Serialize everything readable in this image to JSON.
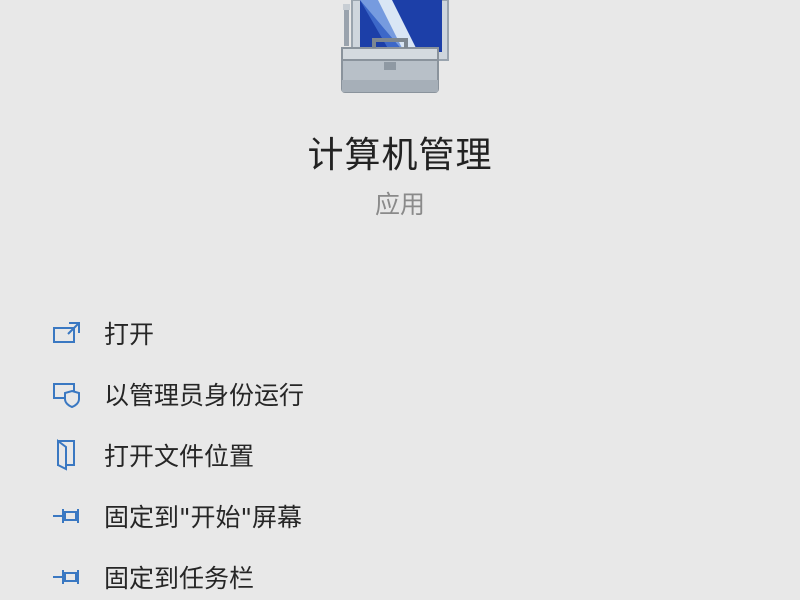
{
  "app": {
    "title": "计算机管理",
    "subtitle": "应用",
    "icon": "computer-management-toolbox-icon"
  },
  "actions": [
    {
      "label": "打开",
      "icon": "open-icon"
    },
    {
      "label": "以管理员身份运行",
      "icon": "run-as-admin-shield-icon"
    },
    {
      "label": "打开文件位置",
      "icon": "file-location-icon"
    },
    {
      "label": "固定到\"开始\"屏幕",
      "icon": "pin-icon"
    },
    {
      "label": "固定到任务栏",
      "icon": "pin-icon"
    }
  ],
  "colors": {
    "background": "#e8e8e8",
    "icon_blue": "#3a78c2",
    "subtitle": "#8a8a8a"
  }
}
